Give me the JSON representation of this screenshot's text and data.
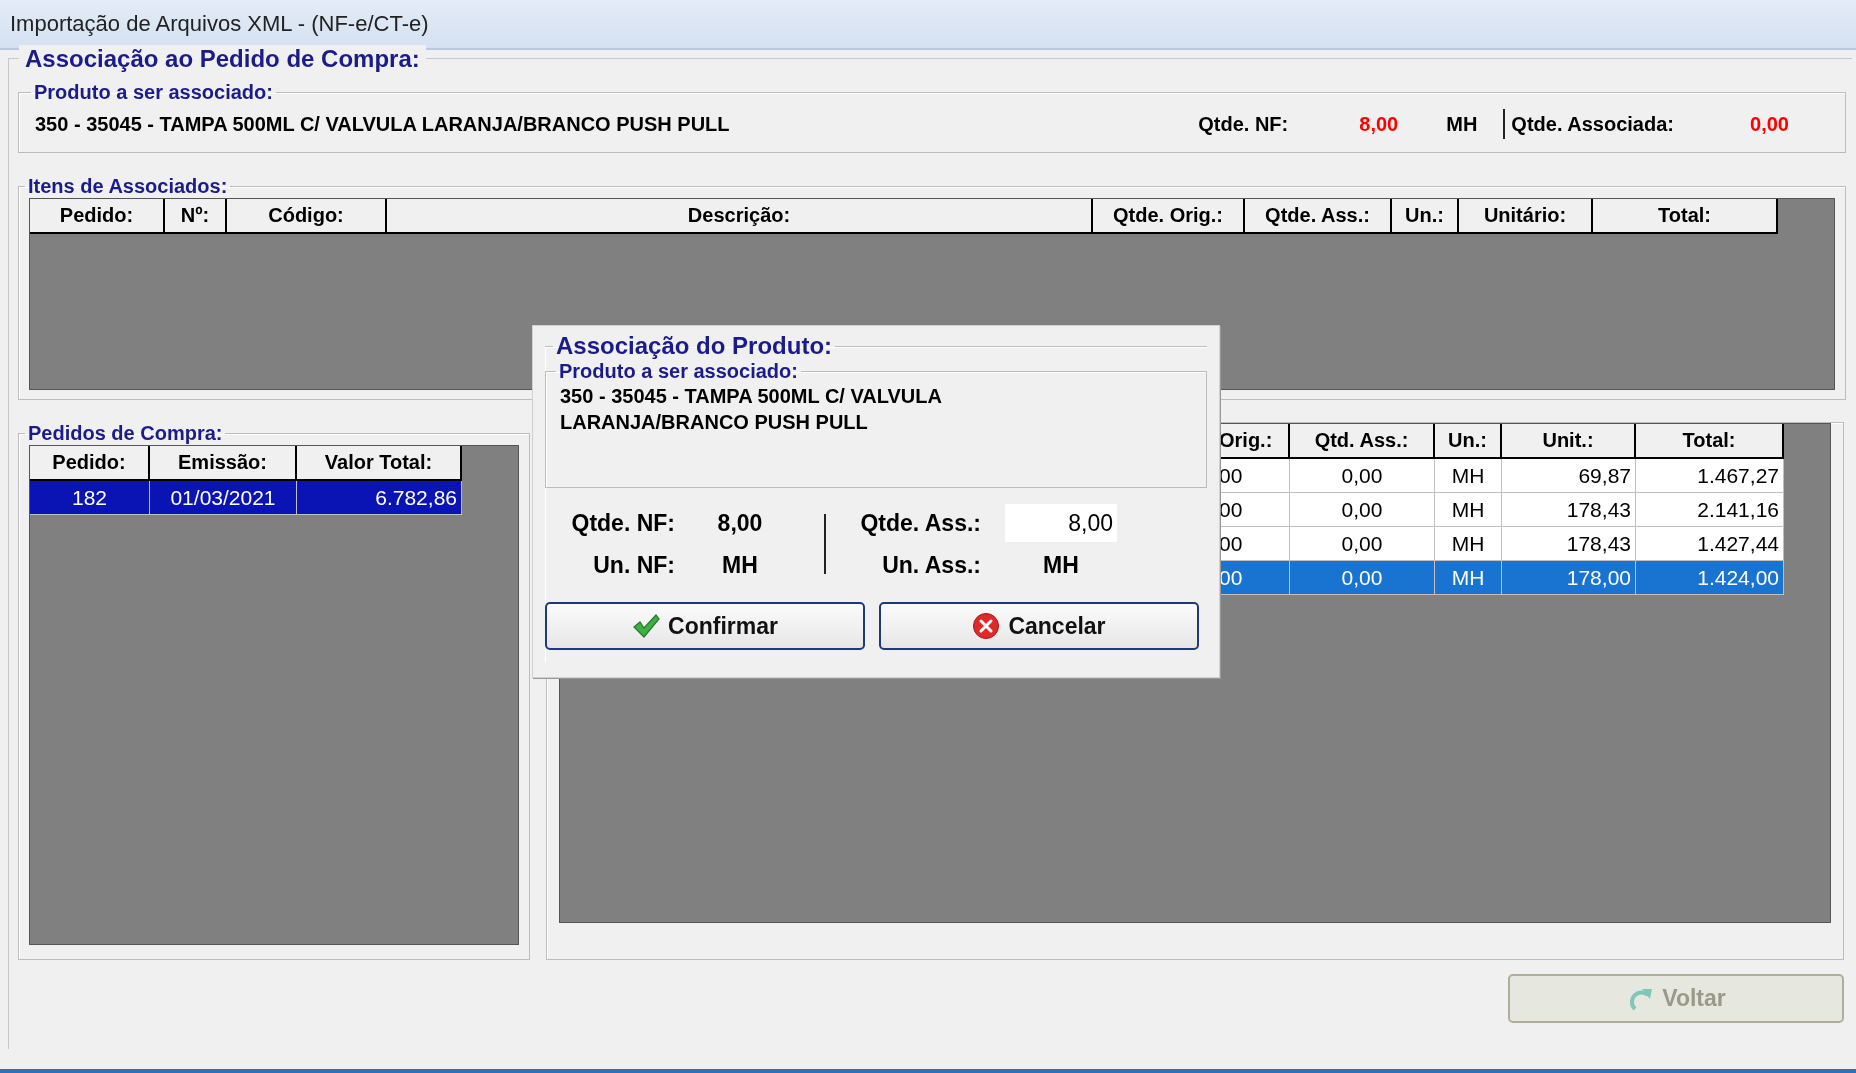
{
  "window": {
    "title": "Importação de Arquivos XML - (NF-e/CT-e)"
  },
  "main_section": {
    "title": "Associação ao Pedido de Compra:"
  },
  "product": {
    "legend": "Produto a ser associado:",
    "description": "350 - 35045 - TAMPA 500ML C/ VALVULA LARANJA/BRANCO PUSH PULL",
    "qty_nf_label": "Qtde. NF:",
    "qty_nf": "8,00",
    "unit": "MH",
    "qty_assoc_label": "Qtde. Associada:",
    "qty_assoc": "0,00"
  },
  "associated_items": {
    "legend": "Itens de Associados:",
    "columns": [
      "Pedido:",
      "Nº:",
      "Código:",
      "Descrição:",
      "Qtde. Orig.:",
      "Qtde. Ass.:",
      "Un.:",
      "Unitário:",
      "Total:"
    ]
  },
  "purchase_orders": {
    "legend": "Pedidos de Compra:",
    "columns": [
      "Pedido:",
      "Emissão:",
      "Valor Total:"
    ],
    "rows": [
      {
        "cells": [
          "182",
          "01/03/2021",
          "6.782,86"
        ],
        "selected": true
      }
    ]
  },
  "order_items": {
    "columns": [
      "Orig.:",
      "Qtd. Ass.:",
      "Un.:",
      "Unit.:",
      "Total:"
    ],
    "rows": [
      {
        "cells": [
          "00",
          "0,00",
          "MH",
          "69,87",
          "1.467,27"
        ],
        "selected": false
      },
      {
        "cells": [
          "00",
          "0,00",
          "MH",
          "178,43",
          "2.141,16"
        ],
        "selected": false
      },
      {
        "cells": [
          "00",
          "0,00",
          "MH",
          "178,43",
          "1.427,44"
        ],
        "selected": false
      },
      {
        "cells": [
          "00",
          "0,00",
          "MH",
          "178,00",
          "1.424,00"
        ],
        "selected": true
      }
    ]
  },
  "dialog": {
    "title": "Associação do Produto:",
    "product_legend": "Produto a ser associado:",
    "product_text": "350 - 35045 - TAMPA 500ML C/ VALVULA LARANJA/BRANCO PUSH PULL",
    "qty_nf_label": "Qtde. NF:",
    "qty_nf": "8,00",
    "un_nf_label": "Un. NF:",
    "un_nf": "MH",
    "qty_ass_label": "Qtde. Ass.:",
    "qty_ass_value": "8,00",
    "un_ass_label": "Un. Ass.:",
    "un_ass": "MH",
    "buttons": [
      {
        "kind": "confirm",
        "label": "Confirmar"
      },
      {
        "kind": "cancel",
        "label": "Cancelar"
      }
    ]
  },
  "back_button": {
    "label": "Voltar",
    "disabled": true
  }
}
